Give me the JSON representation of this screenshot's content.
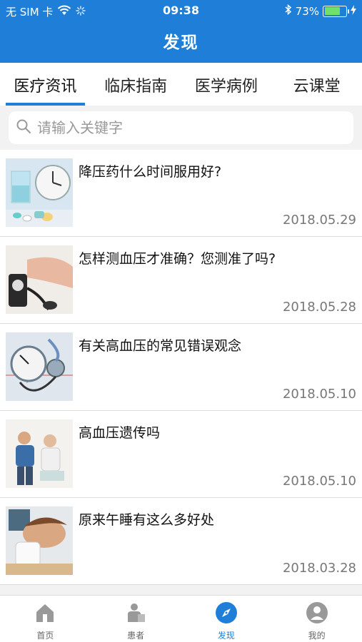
{
  "status_bar": {
    "carrier": "无 SIM 卡",
    "time": "09:38",
    "battery_percent": "73%",
    "battery_level": 0.73
  },
  "header": {
    "title": "发现"
  },
  "tabs": [
    {
      "label": "医疗资讯",
      "active": true
    },
    {
      "label": "临床指南",
      "active": false
    },
    {
      "label": "医学病例",
      "active": false
    },
    {
      "label": "云课堂",
      "active": false
    }
  ],
  "search": {
    "placeholder": "请输入关键字",
    "value": ""
  },
  "articles": [
    {
      "title": "降压药什么时间服用好?",
      "date": "2018.05.29",
      "image": "pills-and-clock-image"
    },
    {
      "title": "怎样测血压才准确？您测准了吗?",
      "date": "2018.05.28",
      "image": "blood-pressure-measuring-image"
    },
    {
      "title": "有关高血压的常见错误观念",
      "date": "2018.05.10",
      "image": "sphygmomanometer-image"
    },
    {
      "title": "高血压遗传吗",
      "date": "2018.05.10",
      "image": "doctor-patient-image"
    },
    {
      "title": "原来午睡有这么多好处",
      "date": "2018.03.28",
      "image": "napping-person-image"
    }
  ],
  "bottom_nav": [
    {
      "label": "首页",
      "icon": "home-icon",
      "active": false
    },
    {
      "label": "患者",
      "icon": "patient-icon",
      "active": false
    },
    {
      "label": "发现",
      "icon": "compass-icon",
      "active": true
    },
    {
      "label": "我的",
      "icon": "profile-icon",
      "active": false
    }
  ],
  "colors": {
    "accent": "#1f7fd8",
    "battery": "#6fe06a"
  }
}
